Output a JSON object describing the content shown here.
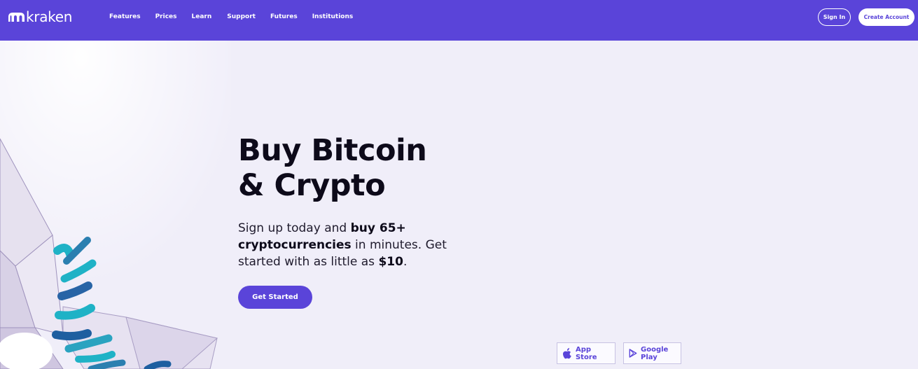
{
  "header": {
    "logo_text": "kraken",
    "logo_icon": "kraken-mark-icon",
    "nav": [
      "Features",
      "Prices",
      "Learn",
      "Support",
      "Futures",
      "Institutions"
    ],
    "sign_in": "Sign In",
    "create_account": "Create Account"
  },
  "hero": {
    "headline_line1": "Buy Bitcoin",
    "headline_line2": "& Crypto",
    "sub_p1": "Sign up today and ",
    "sub_b1": "buy 65+ cryptocurrencies",
    "sub_p2": " in minutes. Get started with as little as ",
    "sub_b2": "$10",
    "sub_p3": ".",
    "cta": "Get Started"
  },
  "apps": {
    "app_store": "App Store",
    "app_store_icon": "apple-icon",
    "google_play": "Google Play",
    "google_play_icon": "google-play-icon"
  },
  "colors": {
    "brand": "#5a44d9",
    "page_background": "#f0eef9",
    "teal_art": "#1fb2c6"
  }
}
